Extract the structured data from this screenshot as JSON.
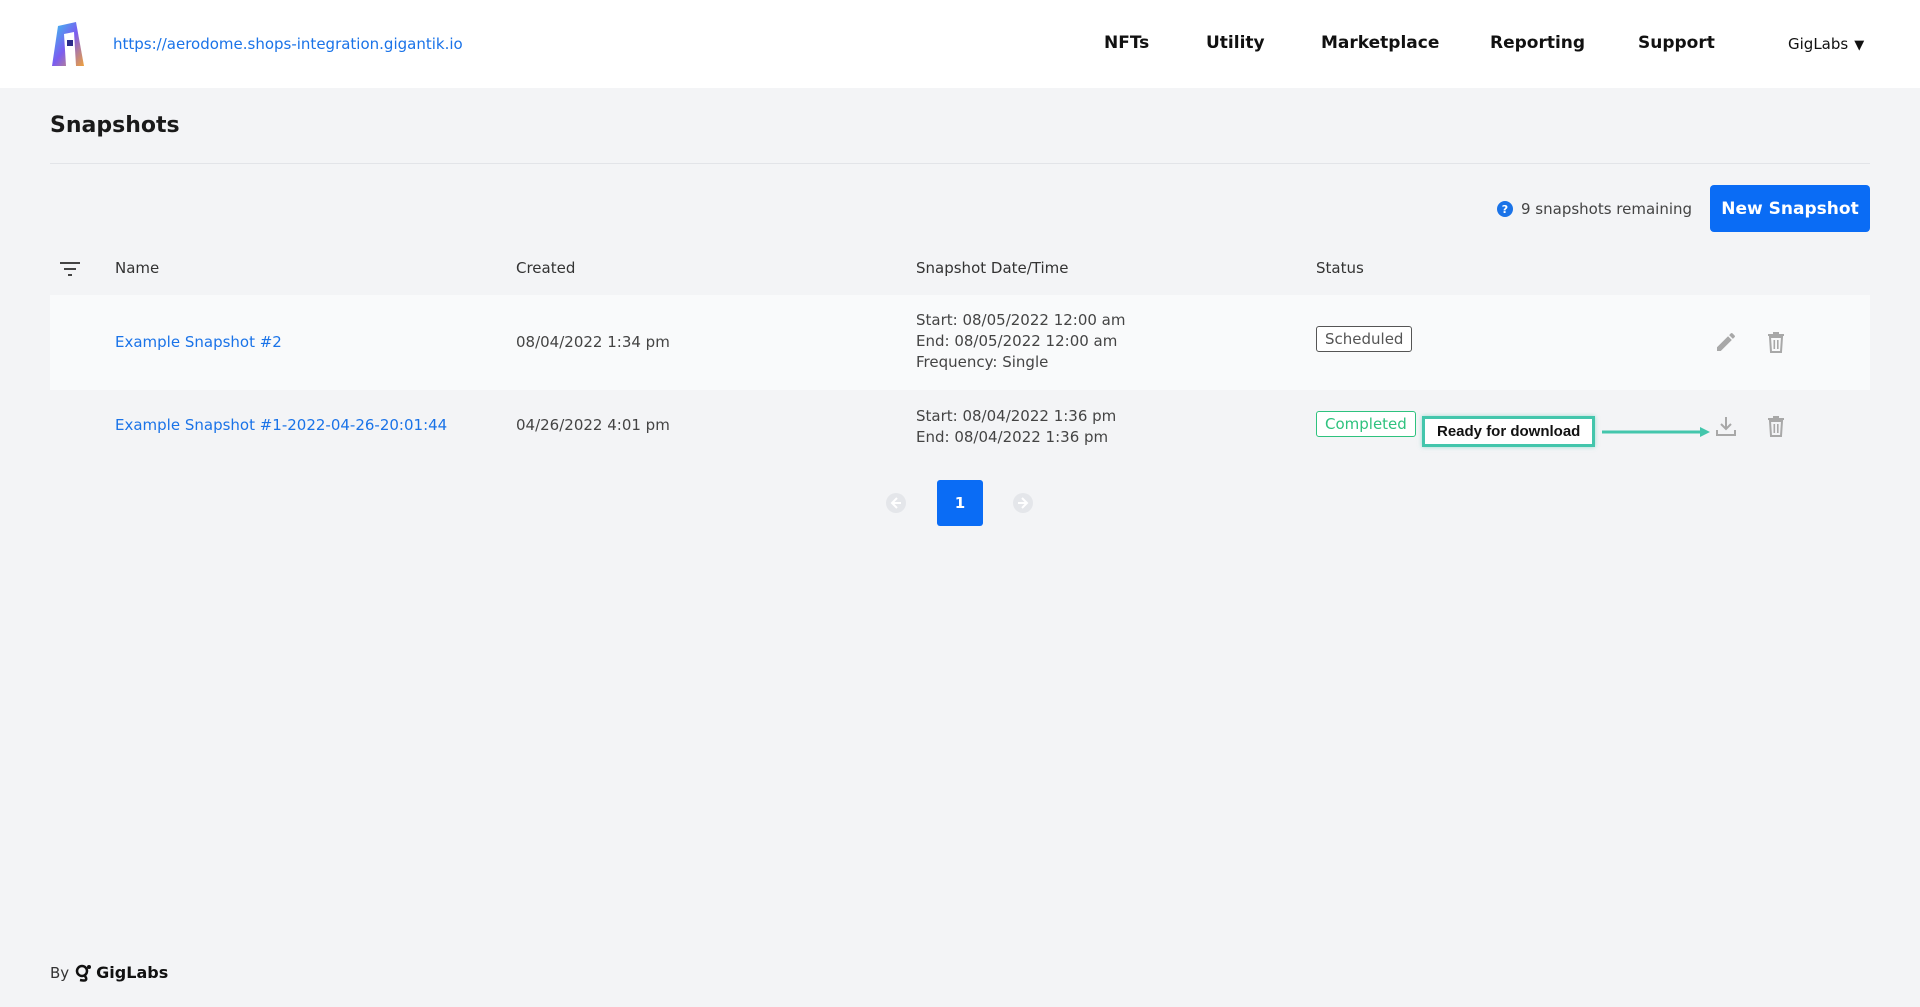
{
  "header": {
    "site_url": "https://aerodome.shops-integration.gigantik.io",
    "nav": [
      "NFTs",
      "Utility",
      "Marketplace",
      "Reporting",
      "Support"
    ],
    "account": "GigLabs",
    "account_caret": "▼"
  },
  "page": {
    "title": "Snapshots",
    "remaining_text": "9 snapshots remaining",
    "help_glyph": "?",
    "new_button": "New Snapshot"
  },
  "table": {
    "columns": [
      "Name",
      "Created",
      "Snapshot Date/Time",
      "Status"
    ],
    "rows": [
      {
        "name": "Example Snapshot #2",
        "created": "08/04/2022 1:34 pm",
        "start": "Start: 08/05/2022 12:00 am",
        "end": "End: 08/05/2022 12:00 am",
        "frequency": "Frequency: Single",
        "status": "Scheduled",
        "actions": [
          "edit-icon",
          "trash-icon"
        ]
      },
      {
        "name": "Example Snapshot #1-2022-04-26-20:01:44",
        "created": "04/26/2022 4:01 pm",
        "start": "Start: 08/04/2022 1:36 pm",
        "end": "End: 08/04/2022 1:36 pm",
        "status": "Completed",
        "actions": [
          "download-icon",
          "trash-icon"
        ]
      }
    ]
  },
  "annotation": {
    "callout": "Ready for download"
  },
  "pagination": {
    "current": "1"
  },
  "footer": {
    "by": "By",
    "brand": "GigLabs"
  },
  "colors": {
    "accent": "#0a6cf5",
    "link": "#1a73e8",
    "completed": "#2ec27e",
    "callout_border": "#43c6ac",
    "background": "#f3f4f6"
  }
}
